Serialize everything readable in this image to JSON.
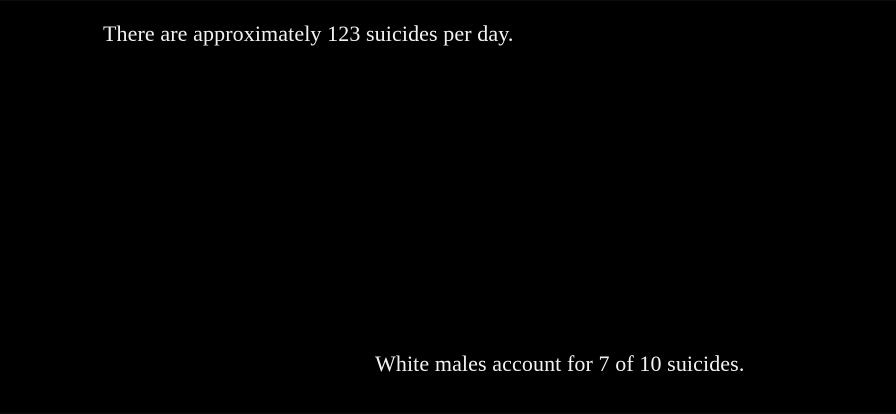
{
  "captions": {
    "top": "There are approximately 123 suicides per day.",
    "bottom": "White males account for 7 of 10 suicides."
  },
  "colors": {
    "background": "#000000",
    "text": "#f2f2f2"
  }
}
